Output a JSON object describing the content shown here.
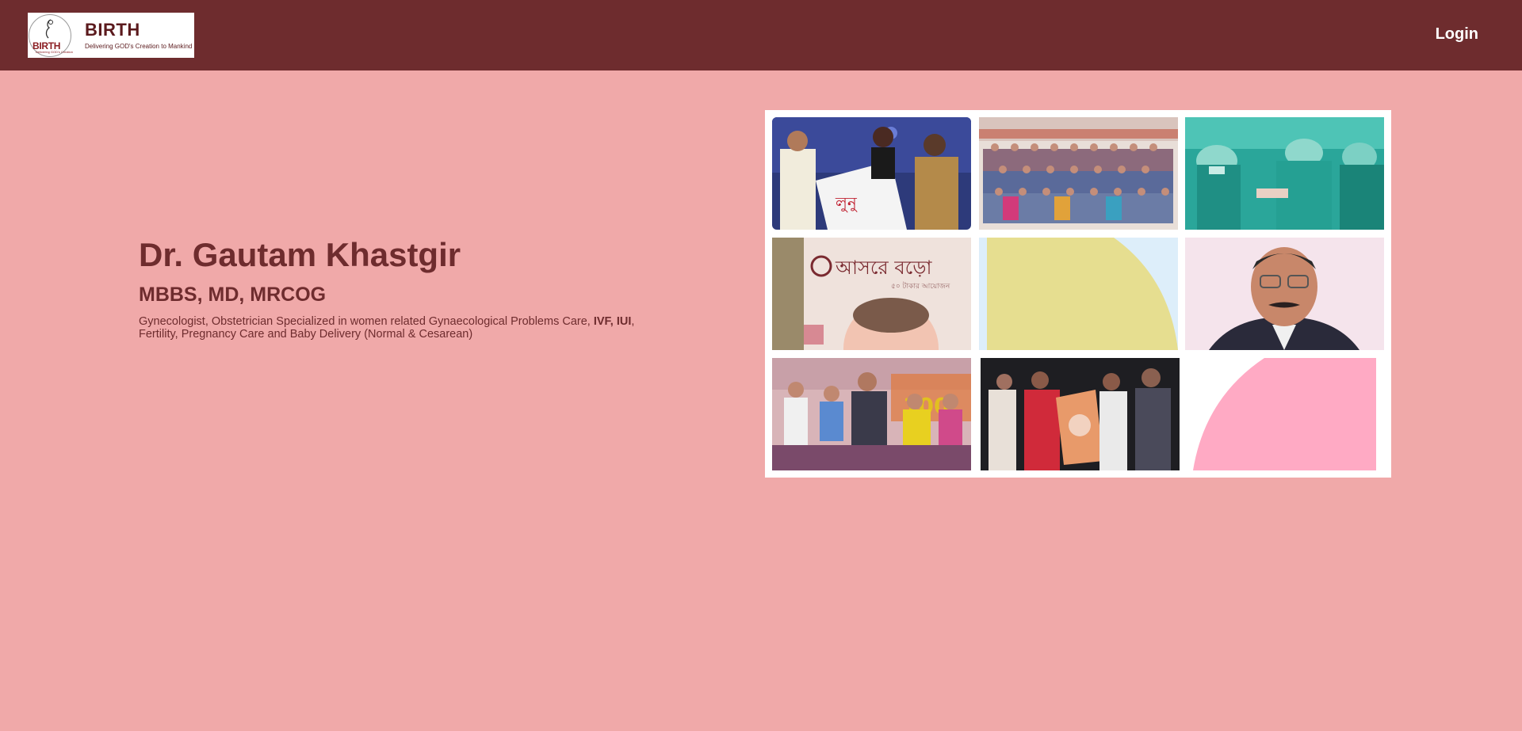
{
  "header": {
    "logo": {
      "title": "BIRTH",
      "tagline": "Delivering GOD's Creation to Mankind",
      "mark_text": "BIRTH",
      "mark_subtext": "Delivering GOD's Creation"
    },
    "login_label": "Login",
    "background_color": "#6e2c2e"
  },
  "hero": {
    "name": "Dr. Gautam Khastgir",
    "degrees": "MBBS, MD, MRCOG",
    "description_before": "Gynecologist, Obstetrician Specialized in women related Gynaecological Problems Care, ",
    "description_bold": "IVF, IUI",
    "description_after": ", Fertility, Pregnancy Care and Baby Delivery (Normal & Cesarean)",
    "text_color": "#6e2c2e"
  },
  "page": {
    "background_color": "#f0a9a9"
  },
  "gallery": {
    "tiles": [
      {
        "id": "award-ceremony-photo"
      },
      {
        "id": "group-photo"
      },
      {
        "id": "surgery-photo"
      },
      {
        "id": "book-cover-photo"
      },
      {
        "id": "yellow-shape-tile"
      },
      {
        "id": "doctor-portrait-photo"
      },
      {
        "id": "children-event-photo"
      },
      {
        "id": "book-launch-photo"
      },
      {
        "id": "pink-shape-tile"
      }
    ]
  }
}
